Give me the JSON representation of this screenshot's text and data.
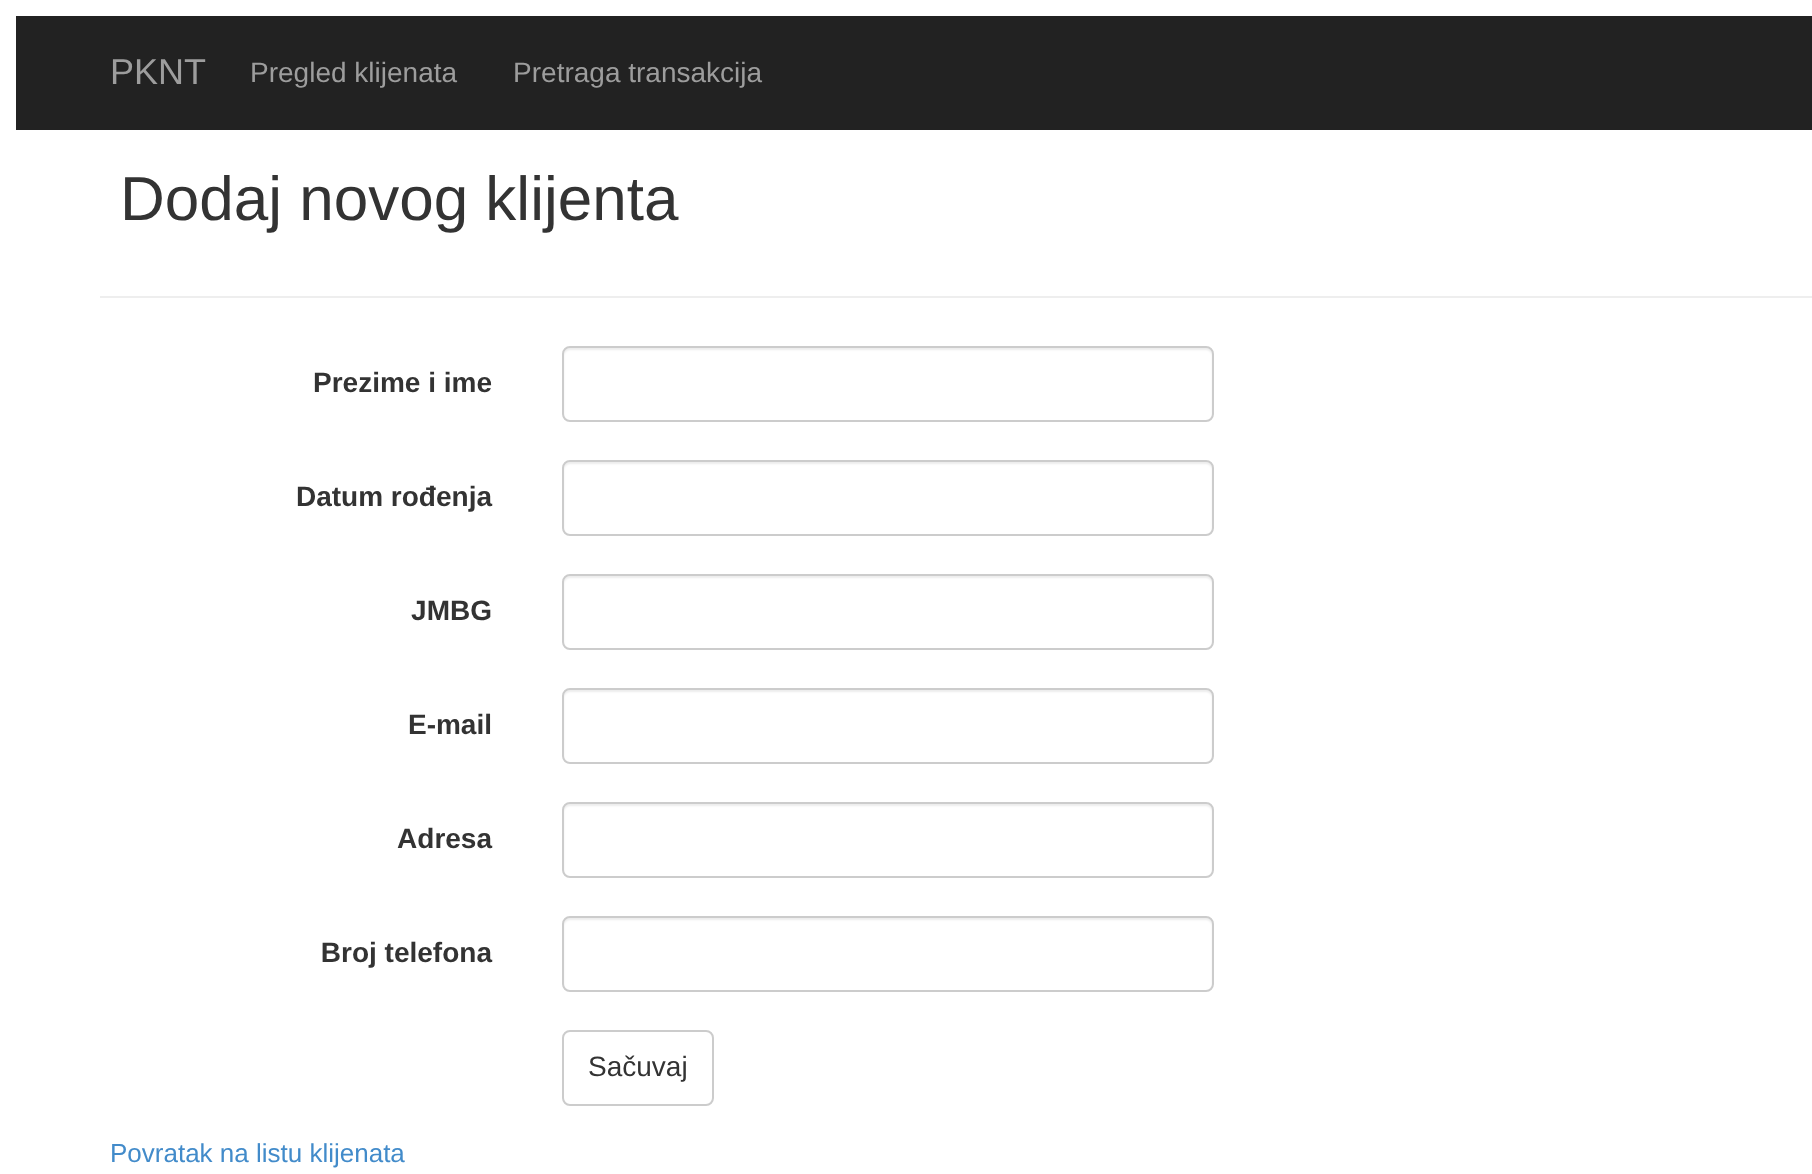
{
  "navbar": {
    "brand": "PKNT",
    "links": [
      "Pregled klijenata",
      "Pretraga transakcija"
    ]
  },
  "page": {
    "title": "Dodaj novog klijenta"
  },
  "form": {
    "fields": [
      {
        "label": "Prezime i ime"
      },
      {
        "label": "Datum rođenja"
      },
      {
        "label": "JMBG"
      },
      {
        "label": "E-mail"
      },
      {
        "label": "Adresa"
      },
      {
        "label": "Broj telefona"
      }
    ],
    "submit": "Sačuvaj"
  },
  "back_link": "Povratak na listu klijenata"
}
